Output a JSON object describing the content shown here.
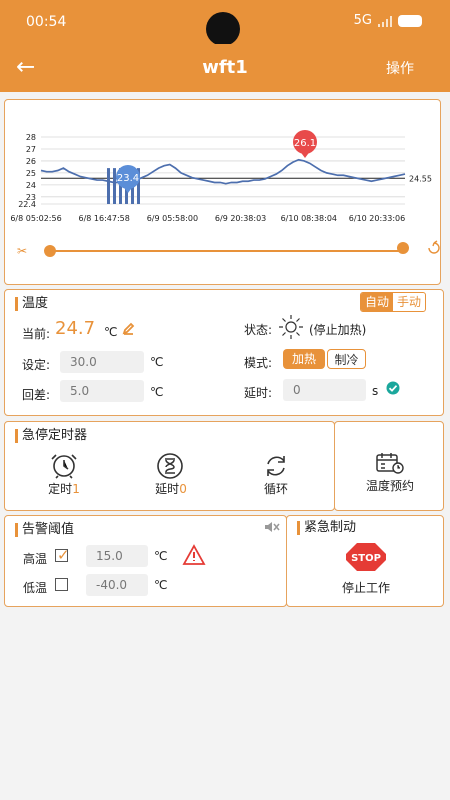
{
  "status_bar": {
    "time": "00:54",
    "network": "5G"
  },
  "nav": {
    "title": "wft1",
    "action": "操作"
  },
  "chart_data": {
    "type": "line",
    "y_ticks": [
      28,
      27,
      26,
      25,
      24,
      23,
      22.4
    ],
    "ylim": [
      22.4,
      28
    ],
    "x_ticks": [
      "6/8 05:02:56",
      "6/8 16:47:58",
      "6/9 05:58:00",
      "6/9 20:38:03",
      "6/10 08:38:04",
      "6/10 20:33:06"
    ],
    "reference_value": 24.55,
    "markers": [
      {
        "label": "23.4",
        "color": "#5b8ed8"
      },
      {
        "label": "26.1",
        "color": "#e84a4a"
      }
    ],
    "line_color": "#4d6fae",
    "series": [
      {
        "values": [
          25.2,
          25.1,
          25.1,
          25.2,
          25.4,
          25.1,
          24.9,
          24.7,
          24.6,
          24.5,
          24.4,
          24.4,
          24.3,
          24.2,
          24.2,
          24.1,
          24.2,
          24.4,
          24.6,
          24.8,
          25.1,
          25.4,
          25.6,
          25.7,
          25.4,
          25.0,
          24.8,
          24.6,
          24.5,
          24.4,
          24.3,
          24.2,
          24.2,
          24.1,
          24.2,
          24.2,
          24.3,
          24.3,
          24.4,
          24.4,
          24.5,
          24.7,
          24.9,
          25.2,
          25.6,
          25.9,
          26.1,
          26.0,
          25.8,
          25.5,
          25.2,
          25.0,
          24.9,
          24.8,
          24.8,
          24.7,
          24.6,
          24.5,
          24.4,
          24.3,
          24.4,
          24.5,
          24.6,
          24.7,
          24.8,
          24.9
        ]
      }
    ],
    "heater_pulses": [
      true,
      true,
      true,
      true,
      true,
      true
    ]
  },
  "temperature": {
    "title": "温度",
    "mode_auto": "自动",
    "mode_manual": "手动",
    "current_label": "当前:",
    "current_value": "24.7",
    "current_unit": "℃",
    "setpoint_label": "设定:",
    "setpoint_value": "30.0",
    "setpoint_unit": "℃",
    "hysteresis_label": "回差:",
    "hysteresis_value": "5.0",
    "hysteresis_unit": "℃",
    "status_label": "状态:",
    "status_text": "(停止加热)",
    "mode_label": "模式:",
    "heat_label": "加热",
    "cool_label": "制冷",
    "delay_label": "延时:",
    "delay_value": "0",
    "delay_unit": "s"
  },
  "timer": {
    "title": "急停定时器",
    "timing_label": "定时",
    "timing_count": "1",
    "delay_label": "延时",
    "delay_count": "0",
    "loop_label": "循环",
    "schedule_label": "温度预约"
  },
  "alarm": {
    "title": "告警阈值",
    "high_label": "高温",
    "high_value": "15.0",
    "high_unit": "℃",
    "low_label": "低温",
    "low_value": "-40.0",
    "low_unit": "℃"
  },
  "emergency": {
    "title": "紧急制动",
    "stop_sign": "STOP",
    "stop_label": "停止工作"
  },
  "colors": {
    "accent": "#e8923a",
    "check": "#1ba79c",
    "alert": "#e53b35"
  }
}
